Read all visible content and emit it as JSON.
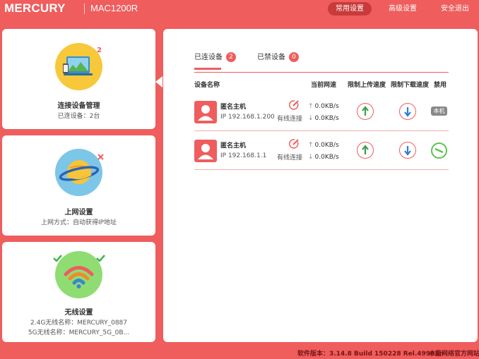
{
  "header": {
    "logo": "MERCURY",
    "model": "MAC1200R",
    "nav": {
      "common": "常用设置",
      "advanced": "高级设置",
      "logout": "安全退出"
    }
  },
  "cards": {
    "devices": {
      "title": "连接设备管理",
      "subtitle": "已连设备：2台",
      "badge": "2"
    },
    "internet": {
      "title": "上网设置",
      "subtitle": "上网方式：自动获得IP地址"
    },
    "wireless": {
      "title": "无线设置",
      "line1": "2.4G无线名称：MERCURY_0887",
      "line2": "5G无线名称：MERCURY_5G_0B..."
    }
  },
  "tabs": [
    {
      "label": "已连设备",
      "count": "2"
    },
    {
      "label": "已禁设备",
      "count": "0"
    }
  ],
  "columns": {
    "name": "设备名称",
    "speed": "当前网速",
    "upload_limit": "限制上传速度",
    "download_limit": "限制下载速度",
    "ban": "禁用"
  },
  "devices": [
    {
      "name": "匿名主机",
      "ip": "IP 192.168.1.200",
      "conn": "有线连接",
      "up": "0.0KB/s",
      "down": "0.0KB/s",
      "local_label": "本机"
    },
    {
      "name": "匿名主机",
      "ip": "IP 192.168.1.1",
      "conn": "有线连接",
      "up": "0.0KB/s",
      "down": "0.0KB/s"
    }
  ],
  "footer": {
    "version": "软件版本：3.14.8 Build 150228 Rel.49905n",
    "site_link": "水星网络官方网站"
  },
  "colors": {
    "brand_red": "#ef5d5d",
    "active_nav": "#c93b3b",
    "upload_arrow": "#3aa04a",
    "download_arrow": "#2f7fd0",
    "ban_green": "#5cc24d",
    "local_badge": "#888888"
  }
}
